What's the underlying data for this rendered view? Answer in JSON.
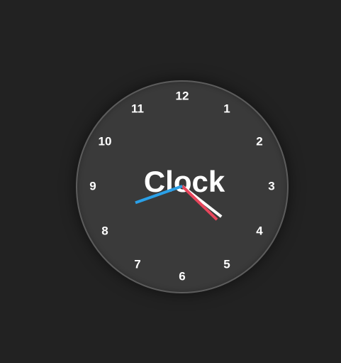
{
  "clock": {
    "title": "Clock",
    "numerals": [
      "12",
      "1",
      "2",
      "3",
      "4",
      "5",
      "6",
      "7",
      "8",
      "9",
      "10",
      "11"
    ],
    "time": {
      "hours": 8,
      "minutes": 21,
      "seconds": 19
    }
  },
  "colors": {
    "background": "#222222",
    "face": "#3a3a3a",
    "rim": "#5c5c5c",
    "hour_hand": "#ffffff",
    "minute_hand": "#e8465c",
    "second_hand": "#2aa0e8"
  }
}
